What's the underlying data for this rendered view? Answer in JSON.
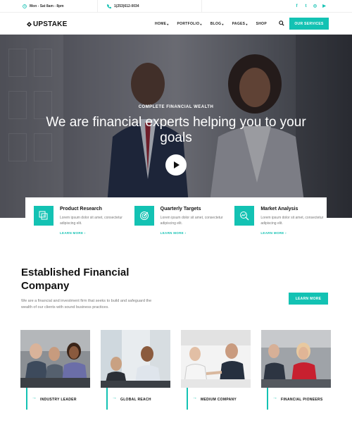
{
  "topbar": {
    "hours": "Mon - Sat 8am - 8pm",
    "phone": "1(253)612-0034",
    "socials": [
      {
        "icon": "facebook-icon",
        "glyph": "f"
      },
      {
        "icon": "twitter-icon",
        "glyph": "t"
      },
      {
        "icon": "instagram-icon",
        "glyph": "◎"
      },
      {
        "icon": "youtube-icon",
        "glyph": "▶"
      }
    ]
  },
  "nav": {
    "logo": "UPSTAKE",
    "menu": [
      {
        "label": "HOME",
        "caret": "▾"
      },
      {
        "label": "PORTFOLIO",
        "caret": "▾"
      },
      {
        "label": "BLOG",
        "caret": "▾"
      },
      {
        "label": "PAGES",
        "caret": "▾"
      },
      {
        "label": "SHOP",
        "caret": ""
      }
    ],
    "cta": "OUR SERVICES"
  },
  "hero": {
    "kicker": "COMPLETE FINANCIAL WEALTH",
    "title": "We are financial experts helping you to your goals"
  },
  "features": [
    {
      "icon": "layers-icon",
      "title": "Product Research",
      "desc": "Lorem ipsum dolor sit amet, consectetur adipiscing elit.",
      "link": "LEARN MORE ›"
    },
    {
      "icon": "target-icon",
      "title": "Quarterly Targets",
      "desc": "Lorem ipsum dolor sit amet, consectetur adipiscing elit.",
      "link": "LEARN MORE ›"
    },
    {
      "icon": "analysis-icon",
      "title": "Market Analysis",
      "desc": "Lorem ipsum dolor sit amet, consectetur adipiscing elit.",
      "link": "LEARN MORE ›"
    }
  ],
  "about": {
    "title": "Established Financial Company",
    "text": "We are a financial and investment firm that seeks to build and safeguard the wealth of our clients with sound business practices.",
    "button": "LEARN MORE"
  },
  "cards": [
    {
      "label": "INDUSTRY LEADER",
      "arrow": "→"
    },
    {
      "label": "GLOBAL REACH",
      "arrow": "→"
    },
    {
      "label": "MEDIUM COMPANY",
      "arrow": "→"
    },
    {
      "label": "FINANCIAL PIONEERS",
      "arrow": "→"
    }
  ],
  "colors": {
    "accent": "#13c2b3",
    "dark": "#111111",
    "muted": "#777777"
  }
}
